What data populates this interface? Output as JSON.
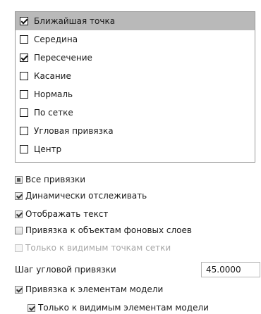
{
  "snap_list": {
    "items": [
      {
        "label": "Ближайшая точка",
        "checked": true,
        "selected": true
      },
      {
        "label": "Середина",
        "checked": false
      },
      {
        "label": "Пересечение",
        "checked": true
      },
      {
        "label": "Касание",
        "checked": false
      },
      {
        "label": "Нормаль",
        "checked": false
      },
      {
        "label": "По сетке",
        "checked": false
      },
      {
        "label": "Угловая привязка",
        "checked": false
      },
      {
        "label": "Центр",
        "checked": false
      }
    ]
  },
  "options": {
    "all_snaps": {
      "label": "Все привязки",
      "state": "indeterminate"
    },
    "dynamic_tracking": {
      "label": "Динамически отслеживать",
      "checked": true
    },
    "show_text": {
      "label": "Отображать текст",
      "checked": true
    },
    "background_layers": {
      "label": "Привязка к объектам фоновых слоев",
      "checked": false
    },
    "visible_grid_only": {
      "label": "Только к видимым точкам сетки",
      "checked": false,
      "disabled": true
    },
    "angle_step": {
      "label": "Шаг угловой привязки",
      "value": "45.0000"
    },
    "model_elements": {
      "label": "Привязка к элементам модели",
      "checked": true
    },
    "visible_model_only": {
      "label": "Только к видимым элементам модели",
      "checked": true
    }
  }
}
